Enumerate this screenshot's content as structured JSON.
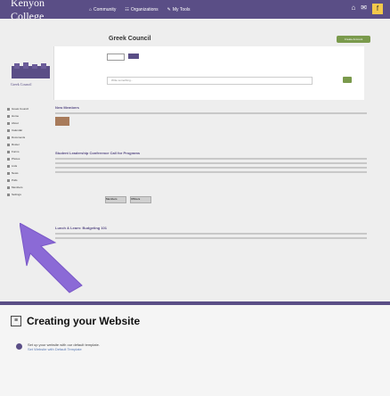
{
  "topbar": {
    "brand": "Kenyon College",
    "nav": [
      "Community",
      "Organizations",
      "My Tools"
    ],
    "icons": [
      "home-icon",
      "bell-icon",
      "facebook-icon"
    ]
  },
  "page": {
    "title": "Greek Council",
    "top_button": "Create Account",
    "logo_text": "Greek Council",
    "search_placeholder": "Write something..."
  },
  "sidebar": {
    "header": "Greek Council",
    "items": [
      "Home",
      "About",
      "Calendar",
      "Documents",
      "Roster",
      "Forms",
      "Photos",
      "Lists",
      "News",
      "Polls",
      "Members",
      "Settings"
    ]
  },
  "content": {
    "new_members": "New Members",
    "post_title": "Student Leadership Conference Call for Programs",
    "tabs": [
      "Members",
      "Officers"
    ],
    "post2_title": "Lunch & Learn: Budgeting 101"
  },
  "help_card": {
    "title": "Creating your Website",
    "step_text": "Set up your website with our default template.",
    "step_link": "Set Website with Default Template"
  }
}
